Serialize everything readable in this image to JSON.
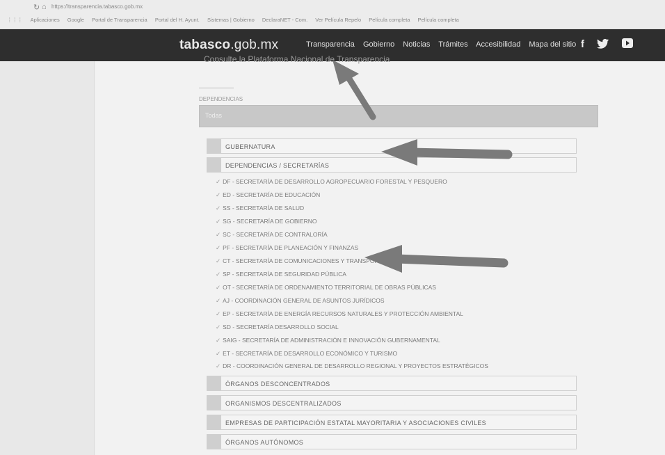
{
  "browser": {
    "url": "https://transparencia.tabasco.gob.mx",
    "bookmarks": [
      "Aplicaciones",
      "Google",
      "Portal de Transparencia",
      "Portal del H. Ayunt.",
      "Sistemas | Gobierno",
      "DeclaraNET - Com.",
      "Ver Película Repelo",
      "Película completa",
      "Película completa"
    ]
  },
  "header": {
    "logo_main": "tabasco",
    "logo_domain": ".gob.mx",
    "nav": [
      "Transparencia",
      "Gobierno",
      "Noticias",
      "Trámites",
      "Accesibilidad",
      "Mapa del sitio"
    ],
    "social_icons": [
      "facebook-icon",
      "twitter-icon",
      "youtube-icon"
    ]
  },
  "page": {
    "faded_title": "Consulte la Plataforma Nacional de Transparencia",
    "dependencias_label": "DEPENDENCIAS",
    "select_value": "Todas",
    "sections": {
      "gubernatura": "GUBERNATURA",
      "dependencias": "DEPENDENCIAS / SECRETARÍAS",
      "desconcentrados": "ÓRGANOS DESCONCENTRADOS",
      "descentralizados": "ORGANISMOS DESCENTRALIZADOS",
      "empresas": "EMPRESAS DE PARTICIPACIÓN ESTATAL MAYORITARIA Y ASOCIACIONES CIVILES",
      "autonomos": "ÓRGANOS AUTÓNOMOS"
    },
    "dependencias_list": [
      "DF - SECRETARÍA DE DESARROLLO AGROPECUARIO FORESTAL Y PESQUERO",
      "ED - SECRETARÍA DE EDUCACIÓN",
      "SS - SECRETARÍA DE SALUD",
      "SG - SECRETARÍA DE GOBIERNO",
      "SC - SECRETARÍA DE CONTRALORÍA",
      "PF - SECRETARÍA DE PLANEACIÓN Y FINANZAS",
      "CT - SECRETARÍA DE COMUNICACIONES Y TRANSPORTES",
      "SP - SECRETARÍA DE SEGURIDAD PÚBLICA",
      "OT - SECRETARÍA DE ORDENAMIENTO TERRITORIAL DE OBRAS PÚBLICAS",
      "AJ - COORDINACIÓN GENERAL DE ASUNTOS JURÍDICOS",
      "EP - SECRETARÍA DE ENERGÍA RECURSOS NATURALES Y PROTECCIÓN AMBIENTAL",
      "SD - SECRETARÍA DESARROLLO SOCIAL",
      "SAIG - SECRETARÍA DE ADMINISTRACIÓN E INNOVACIÓN GUBERNAMENTAL",
      "ET - SECRETARÍA DE DESARROLLO ECONÓMICO Y TURISMO",
      "DR - COORDINACIÓN GENERAL DE DESARROLLO REGIONAL Y PROYECTOS ESTRATÉGICOS"
    ]
  },
  "colors": {
    "header_bg": "#2e2e2e",
    "arrow": "#7a7a7a"
  }
}
